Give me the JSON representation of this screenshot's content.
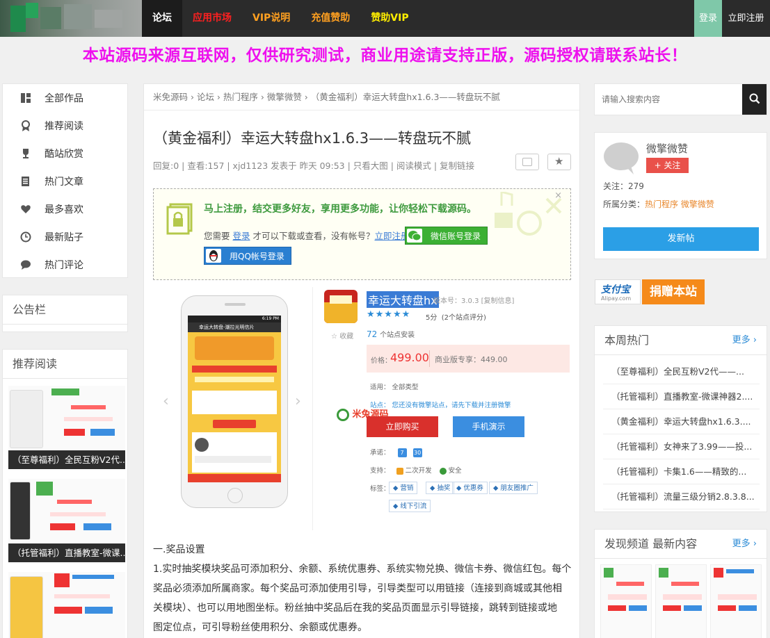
{
  "nav": {
    "items": [
      {
        "label": "论坛",
        "color": "#ffffff"
      },
      {
        "label": "应用市场",
        "color": "#ff2020"
      },
      {
        "label": "VIP说明",
        "color": "#ffa020"
      },
      {
        "label": "充值赞助",
        "color": "#ffa020"
      },
      {
        "label": "赞助VIP",
        "color": "#ffee00"
      }
    ],
    "login": "登录",
    "register": "立即注册"
  },
  "notice": "本站源码来源互联网，仅供研究测试，商业用途请支持正版，源码授权请联系站长！",
  "left": {
    "menu": [
      {
        "label": "全部作品",
        "icon": "grid-icon"
      },
      {
        "label": "推荐阅读",
        "icon": "award-icon"
      },
      {
        "label": "酷站欣赏",
        "icon": "trophy-icon"
      },
      {
        "label": "热门文章",
        "icon": "document-icon"
      },
      {
        "label": "最多喜欢",
        "icon": "heart-icon"
      },
      {
        "label": "最新贴子",
        "icon": "clock-icon"
      },
      {
        "label": "热门评论",
        "icon": "comment-icon"
      }
    ],
    "board_title": "公告栏",
    "rec_title": "推荐阅读",
    "rec_items": [
      "（至尊福利）全民互粉V2代...",
      "（托管福利）直播教室-微课...",
      ""
    ]
  },
  "main": {
    "breadcrumb": "米免源码 › 论坛 › 热门程序 › 微擎微赞 › （黄金福利）幸运大转盘hx1.6.3——转盘玩不腻",
    "title": "（黄金福利）幸运大转盘hx1.6.3——转盘玩不腻",
    "meta": "回复:0  |  查看:157  |  xjd1123 发表于 昨天 09:53  | 只看大图  | 阅读模式  | 复制链接",
    "reg_head": "马上注册，结交更多好友，享用更多功能，让你轻松下载源码。",
    "reg_line_prefix": "您需要",
    "reg_login": "登录",
    "reg_line_mid": "才可以下载或查看，没有帐号？",
    "reg_register": "立即注册",
    "wx_login": "微信账号登录",
    "qq_login": "用QQ帐号登录",
    "product": {
      "name": "幸运大转盘hx",
      "version": "版本号：3.0.3  [复制信息]",
      "score": "5分",
      "score_note": "(2个站点评分)",
      "favorite": "收藏",
      "installs": "72",
      "installs_label": "个站点安装",
      "price_label": "价格：",
      "price": "499.00",
      "biz_price": "商业版专享：449.00",
      "applies": "适用：  全部类型",
      "site": "站点：  您还没有微擎站点，请先下载并注册微擎",
      "watermark": "米兔源码",
      "buy": "立即购买",
      "demo": "手机演示",
      "promise": "承诺：",
      "promise_badges": [
        "7",
        "30"
      ],
      "support": "支持：",
      "support_items": [
        "二次开发",
        "安全"
      ],
      "tags_label": "标签：",
      "tags": [
        "营销",
        "抽奖",
        "优惠券",
        "朋友圈推广",
        "线下引流"
      ],
      "phone_title": "幸运大转盘-潮拉光明信片",
      "phone_time": "6:19 PM"
    },
    "section_title": "一.奖品设置",
    "paragraphs": [
      "1.实时抽奖模块奖品可添加积分、余额、系统优惠券、系统实物兑换、微信卡券、微信红包。每个",
      "奖品必须添加所属商家。每个奖品可添加使用引导，引导类型可以用链接（连接到商城或其他相",
      "关模块）、也可以用地图坐标。粉丝抽中奖品后在我的奖品页面显示引导链接，跳转到链接或地",
      "图定位点，可引导粉丝使用积分、余额或优惠券。"
    ]
  },
  "right": {
    "search_placeholder": "请输入搜索内容",
    "author_name": "微擎微赞",
    "follow": "+ 关注",
    "follow_count": "关注：279",
    "category_label": "所属分类：",
    "categories": "热门程序 微擎微赞",
    "publish": "发新帖",
    "donate_brand": "支付宝",
    "donate_sub": "Alipay.com",
    "donate_label": "捐赠本站",
    "hot_title": "本周热门",
    "more": "更多 ›",
    "hot_items": [
      "（至尊福利）全民互粉V2代——...",
      "（托管福利）直播教室-微课神器2....",
      "（黄金福利）幸运大转盘hx1.6.3....",
      "（托管福利）女神来了3.99——投...",
      "（托管福利）卡集1.6——精致的...",
      "（托管福利）流量三级分销2.8.3.8..."
    ],
    "discover_title": "发现频道 最新内容",
    "discover_more": "更多 ›"
  }
}
